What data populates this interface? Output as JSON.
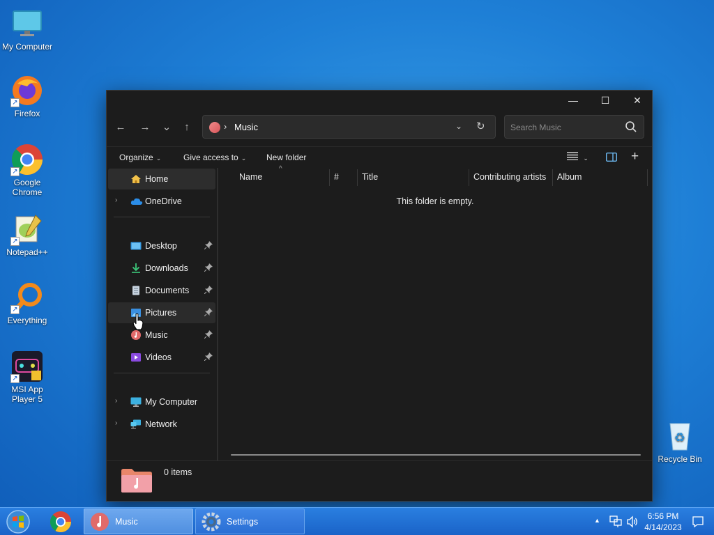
{
  "desktop": {
    "icons": [
      {
        "label": "My Computer"
      },
      {
        "label": "Firefox"
      },
      {
        "label": "Google Chrome"
      },
      {
        "label": "Notepad++"
      },
      {
        "label": "Everything"
      },
      {
        "label": "MSI App Player 5"
      },
      {
        "label": "Recycle Bin"
      }
    ]
  },
  "window": {
    "controls": {
      "minimize": "—",
      "maximize": "☐",
      "close": "✕"
    },
    "nav": {
      "back": "←",
      "forward": "→",
      "recent": "⌄",
      "up": "↑"
    },
    "address": {
      "separator": "›",
      "location": "Music",
      "dropdown": "⌄",
      "refresh": "↻"
    },
    "search": {
      "placeholder": "Search Music"
    },
    "commands": {
      "organize": "Organize",
      "give_access": "Give access to",
      "new_folder": "New folder",
      "chevron": "⌄",
      "add": "+"
    },
    "navpane": {
      "home": "Home",
      "onedrive": "OneDrive",
      "desktop": "Desktop",
      "downloads": "Downloads",
      "documents": "Documents",
      "pictures": "Pictures",
      "music": "Music",
      "videos": "Videos",
      "my_computer": "My Computer",
      "network": "Network",
      "expander": "›"
    },
    "columns": {
      "name": "Name",
      "number": "#",
      "title": "Title",
      "contributing_artists": "Contributing artists",
      "album": "Album",
      "sort_indicator": "^"
    },
    "empty_message": "This folder is empty.",
    "status": {
      "item_count": "0 items"
    }
  },
  "taskbar": {
    "tasks": [
      {
        "label": "Music"
      },
      {
        "label": "Settings"
      }
    ],
    "tray": {
      "expand": "▲"
    },
    "clock": {
      "time": "6:56 PM",
      "date": "4/14/2023"
    }
  }
}
